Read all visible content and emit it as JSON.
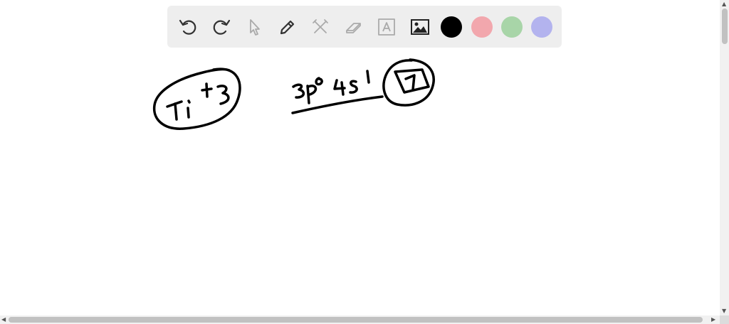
{
  "toolbar": {
    "tools": [
      "undo-icon",
      "redo-icon",
      "pointer-icon",
      "pen-icon",
      "tools-icon",
      "eraser-icon",
      "text-icon",
      "image-icon"
    ],
    "colors": [
      "#000000",
      "#f2a7ad",
      "#a8d5a8",
      "#b3b3ee"
    ]
  },
  "canvas": {
    "ink_color": "#000000"
  },
  "scrollbars": {
    "up_arrow": "▲",
    "down_arrow": "▼",
    "left_arrow": "◀",
    "right_arrow": "▶"
  }
}
